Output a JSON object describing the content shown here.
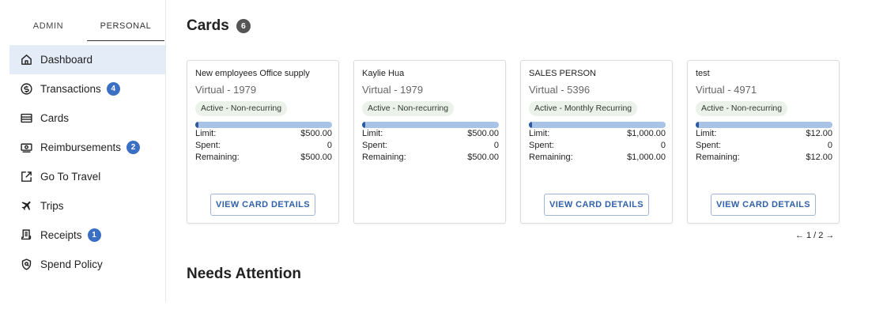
{
  "tabs": [
    {
      "label": "ADMIN"
    },
    {
      "label": "PERSONAL"
    }
  ],
  "nav": [
    {
      "label": "Dashboard",
      "icon": "home-icon",
      "badge": ""
    },
    {
      "label": "Transactions",
      "icon": "dollar-circle-icon",
      "badge": "4"
    },
    {
      "label": "Cards",
      "icon": "credit-card-icon",
      "badge": ""
    },
    {
      "label": "Reimbursements",
      "icon": "cash-icon",
      "badge": "2"
    },
    {
      "label": "Go To Travel",
      "icon": "external-link-icon",
      "badge": ""
    },
    {
      "label": "Trips",
      "icon": "airplane-icon",
      "badge": ""
    },
    {
      "label": "Receipts",
      "icon": "receipt-icon",
      "badge": "1"
    },
    {
      "label": "Spend Policy",
      "icon": "shield-icon",
      "badge": ""
    }
  ],
  "main": {
    "title": "Cards",
    "count": "6",
    "pager": {
      "prev": "←",
      "text": "1 / 2",
      "next": "→"
    },
    "needs_attention": "Needs Attention"
  },
  "cards": [
    {
      "name": "New employees Office supply",
      "type": "Virtual - 1979",
      "status": "Active - Non-recurring",
      "spent_fraction": 0.0,
      "limit_label": "Limit:",
      "limit": "$500.00",
      "spent_label": "Spent:",
      "spent": "0",
      "remaining_label": "Remaining:",
      "remaining": "$500.00",
      "button": "VIEW CARD DETAILS"
    },
    {
      "name": "Kaylie Hua",
      "type": "Virtual - 1979",
      "status": "Active - Non-recurring",
      "spent_fraction": 0.0,
      "limit_label": "Limit:",
      "limit": "$500.00",
      "spent_label": "Spent:",
      "spent": "0",
      "remaining_label": "Remaining:",
      "remaining": "$500.00",
      "button": ""
    },
    {
      "name": "SALES PERSON",
      "type": "Virtual - 5396",
      "status": "Active - Monthly Recurring",
      "spent_fraction": 0.0,
      "limit_label": "Limit:",
      "limit": "$1,000.00",
      "spent_label": "Spent:",
      "spent": "0",
      "remaining_label": "Remaining:",
      "remaining": "$1,000.00",
      "button": "VIEW CARD DETAILS"
    },
    {
      "name": "test",
      "type": "Virtual - 4971",
      "status": "Active - Non-recurring",
      "spent_fraction": 0.0,
      "limit_label": "Limit:",
      "limit": "$12.00",
      "spent_label": "Spent:",
      "spent": "0",
      "remaining_label": "Remaining:",
      "remaining": "$12.00",
      "button": "VIEW CARD DETAILS"
    }
  ],
  "colors": {
    "accent": "#3a6fc4",
    "active_nav_bg": "#e3ecf7",
    "progress_track": "#a9c3e6",
    "progress_fill": "#2c5aa0",
    "status_pill_bg": "#eaf2ea"
  }
}
